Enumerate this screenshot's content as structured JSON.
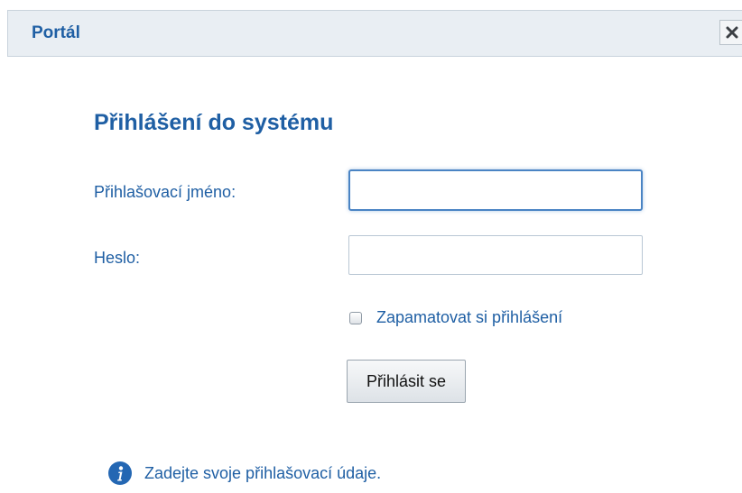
{
  "window": {
    "title": "Portál",
    "close_icon": "close-icon"
  },
  "login": {
    "heading": "Přihlášení do systému",
    "username_label": "Přihlašovací jméno:",
    "username_value": "",
    "password_label": "Heslo:",
    "password_value": "",
    "remember_label": "Zapamatovat si přihlášení",
    "remember_checked": false,
    "submit_label": "Přihlásit se"
  },
  "info": {
    "icon": "info-icon",
    "message": "Zadejte svoje přihlašovací údaje."
  },
  "colors": {
    "accent": "#1f5fa4",
    "titlebar_bg": "#e9eef3",
    "info_icon": "#2467b3"
  }
}
